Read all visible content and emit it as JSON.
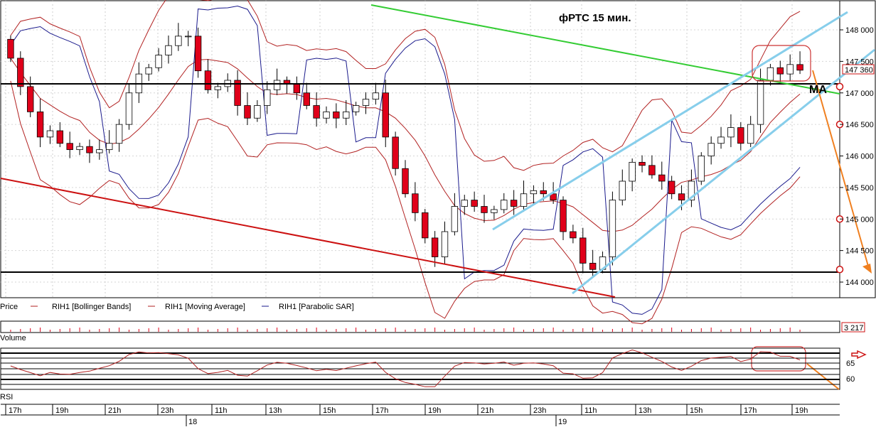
{
  "title": "фРТС   15 мин.",
  "price_panel": {
    "label": "Price",
    "last_price": "147 360",
    "y_ticks": [
      "148 000",
      "147 500",
      "147 000",
      "146 500",
      "146 000",
      "145 500",
      "145 000",
      "144 500",
      "144 000"
    ],
    "legend": [
      {
        "label": "RIH1 [Bollinger Bands]",
        "color": "#b22222"
      },
      {
        "label": "RIH1 [Moving Average]",
        "color": "#b22222"
      },
      {
        "label": "RIH1 [Parabolic SAR]",
        "color": "#1a1a8c"
      }
    ],
    "annotation": "MA"
  },
  "volume_panel": {
    "label": "Volume",
    "last_value": "3 217"
  },
  "rsi_panel": {
    "label": "RSI",
    "ticks": [
      "65",
      "60"
    ]
  },
  "time_axis": {
    "hours": [
      "17h",
      "19h",
      "21h",
      "23h",
      "11h",
      "13h",
      "15h",
      "17h",
      "19h",
      "21h",
      "23h",
      "11h",
      "13h",
      "15h",
      "17h",
      "19h"
    ],
    "days": [
      "18",
      "19"
    ]
  },
  "colors": {
    "up": "#ffffff",
    "down": "#e0001a",
    "bollinger": "#b22222",
    "sar": "#1a1a8c",
    "trend_red": "#cc1111",
    "trend_green": "#33cc33",
    "trend_blue": "#87ceeb",
    "arrow": "#f08020"
  },
  "chart_data": {
    "type": "candlestick",
    "title": "фРТС   15 мин.",
    "ylim": [
      143900,
      148150
    ],
    "series": [
      {
        "name": "RIH1",
        "values": [
          147550,
          147100,
          146700,
          146300,
          146400,
          146200,
          146100,
          146150,
          146050,
          146100,
          146200,
          146500,
          147000,
          147300,
          147400,
          147600,
          147750,
          147900,
          147900,
          147350,
          147050,
          147100,
          147200,
          146800,
          146600,
          146800,
          147050,
          147200,
          147150,
          147000,
          146800,
          146600,
          146700,
          146600,
          146700,
          146800,
          146900,
          147000,
          146300,
          145800,
          145400,
          145100,
          144700,
          144400,
          144800,
          145200,
          145300,
          145200,
          145100,
          145150,
          145300,
          145200,
          145400,
          145450,
          145400,
          145300,
          144800,
          144700,
          144300,
          144200,
          144400,
          145300,
          145600,
          145900,
          145850,
          145700,
          145600,
          145400,
          145300,
          145600,
          146000,
          146200,
          146300,
          146450,
          146200,
          146500,
          147200,
          147400,
          147300,
          147450,
          147360
        ]
      }
    ]
  }
}
